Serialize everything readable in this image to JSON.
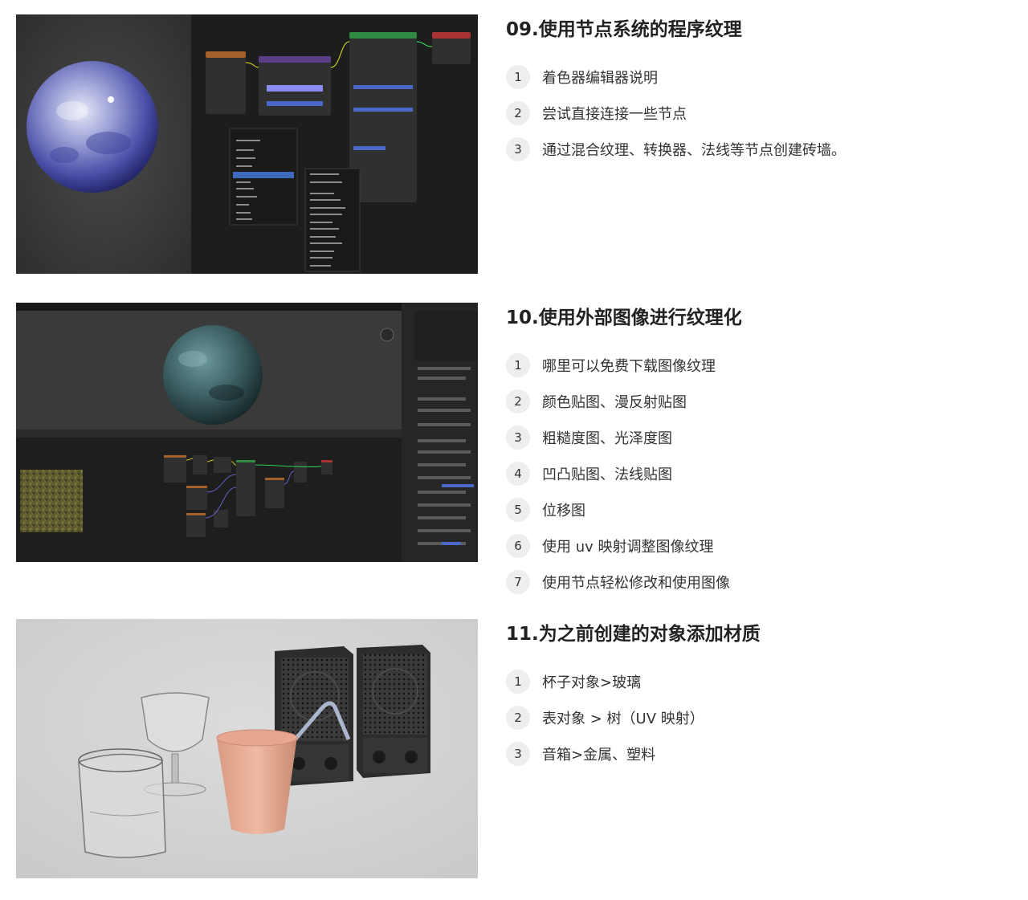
{
  "sections": [
    {
      "title": "09.使用节点系统的程序纹理",
      "items": [
        {
          "num": "1",
          "text": "着色器编辑器说明"
        },
        {
          "num": "2",
          "text": "尝试直接连接一些节点"
        },
        {
          "num": "3",
          "text": "通过混合纹理、转换器、法线等节点创建砖墙。"
        }
      ]
    },
    {
      "title": "10.使用外部图像进行纹理化",
      "items": [
        {
          "num": "1",
          "text": "哪里可以免费下载图像纹理"
        },
        {
          "num": "2",
          "text": "颜色贴图、漫反射贴图"
        },
        {
          "num": "3",
          "text": "粗糙度图、光泽度图"
        },
        {
          "num": "4",
          "text": "凹凸贴图、法线贴图"
        },
        {
          "num": "5",
          "text": "位移图"
        },
        {
          "num": "6",
          "text": "使用 uv 映射调整图像纹理"
        },
        {
          "num": "7",
          "text": "使用节点轻松修改和使用图像"
        }
      ]
    },
    {
      "title": "11.为之前创建的对象添加材质",
      "items": [
        {
          "num": "1",
          "text": "杯子对象>玻璃"
        },
        {
          "num": "2",
          "text": "表对象 > 树（UV 映射）"
        },
        {
          "num": "3",
          "text": "音箱>金属、塑料"
        }
      ]
    }
  ],
  "colors": {
    "badge_bg": "#eeeeee",
    "title_text": "#222222",
    "item_text": "#333333",
    "editor_bg": "#1d1d1d"
  }
}
